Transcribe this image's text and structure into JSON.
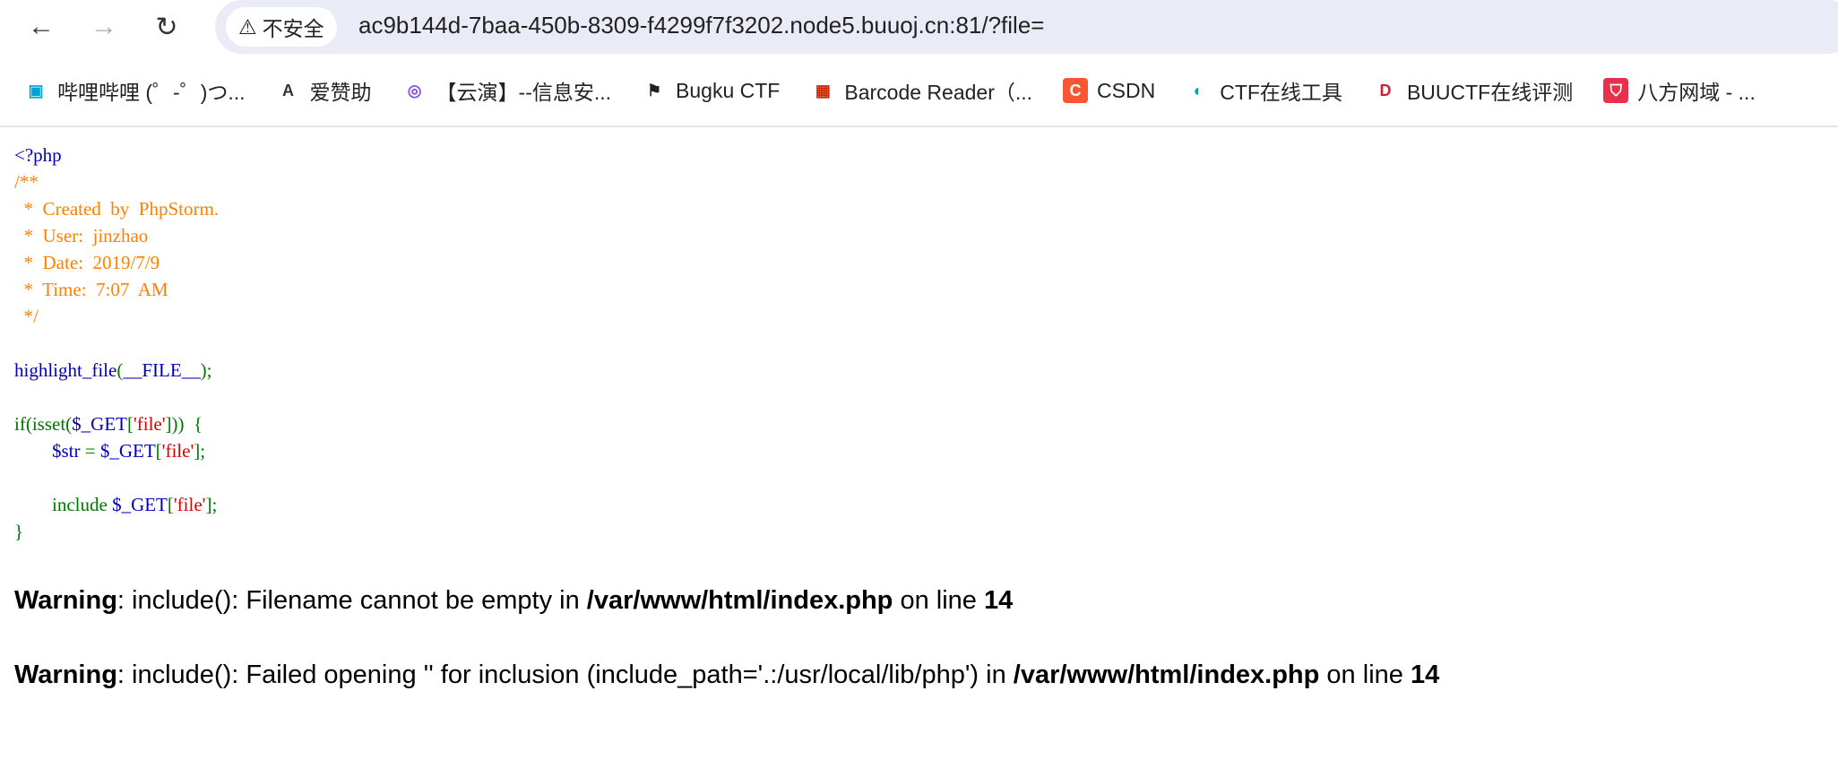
{
  "browser": {
    "security_label": "不安全",
    "url": "ac9b144d-7baa-450b-8309-f4299f7f3202.node5.buuoj.cn:81/?file=",
    "bookmarks": [
      {
        "label": "哔哩哔哩 (゜-゜)つ...",
        "icon": "bilibili-icon",
        "color": "#00a1d6"
      },
      {
        "label": "爱赞助",
        "icon": "aizanzhu-icon",
        "color": "#333333"
      },
      {
        "label": "【云演】--信息安...",
        "icon": "target-icon",
        "color": "#8a4fd8"
      },
      {
        "label": "Bugku CTF",
        "icon": "checkered-flag-icon",
        "color": "#222222"
      },
      {
        "label": "Barcode Reader（...",
        "icon": "barcode-reader-icon",
        "color": "#cc2200"
      },
      {
        "label": "CSDN",
        "icon": "csdn-icon",
        "color": "#fc5531"
      },
      {
        "label": "CTF在线工具",
        "icon": "ctf-tools-icon",
        "color": "#1a9e8f"
      },
      {
        "label": "BUUCTF在线评测",
        "icon": "dasctf-icon",
        "color": "#cc2233"
      },
      {
        "label": "八方网域 - ...",
        "icon": "shield-icon",
        "color": "#e8304a"
      }
    ]
  },
  "code": [
    [
      {
        "t": "<?php",
        "c": "blue"
      }
    ],
    [
      {
        "t": "/**",
        "c": "orange"
      }
    ],
    [
      {
        "t": "  *  Created  by  PhpStorm.",
        "c": "orange"
      }
    ],
    [
      {
        "t": "  *  User:  jinzhao",
        "c": "orange"
      }
    ],
    [
      {
        "t": "  *  Date:  2019/7/9",
        "c": "orange"
      }
    ],
    [
      {
        "t": "  *  Time:  7:07  AM",
        "c": "orange"
      }
    ],
    [
      {
        "t": "  */",
        "c": "orange"
      }
    ],
    [],
    [
      {
        "t": "highlight_file",
        "c": "blue"
      },
      {
        "t": "(",
        "c": "green"
      },
      {
        "t": "__FILE__",
        "c": "blue"
      },
      {
        "t": ");",
        "c": "green"
      }
    ],
    [],
    [
      {
        "t": "if(isset(",
        "c": "green"
      },
      {
        "t": "$_GET",
        "c": "blue"
      },
      {
        "t": "[",
        "c": "green"
      },
      {
        "t": "'file'",
        "c": "red"
      },
      {
        "t": "]))  {",
        "c": "green"
      }
    ],
    [
      {
        "t": "        ",
        "c": "green"
      },
      {
        "t": "$str ",
        "c": "blue"
      },
      {
        "t": "= ",
        "c": "green"
      },
      {
        "t": "$_GET",
        "c": "blue"
      },
      {
        "t": "[",
        "c": "green"
      },
      {
        "t": "'file'",
        "c": "red"
      },
      {
        "t": "];",
        "c": "green"
      }
    ],
    [],
    [
      {
        "t": "        include ",
        "c": "green"
      },
      {
        "t": "$_GET",
        "c": "blue"
      },
      {
        "t": "[",
        "c": "green"
      },
      {
        "t": "'file'",
        "c": "red"
      },
      {
        "t": "];",
        "c": "green"
      }
    ],
    [
      {
        "t": "}",
        "c": "green"
      }
    ]
  ],
  "warnings": [
    {
      "label": "Warning",
      "message": ": include(): Filename cannot be empty in ",
      "file": "/var/www/html/index.php",
      "on_line": " on line ",
      "line": "14"
    },
    {
      "label": "Warning",
      "message": ": include(): Failed opening '' for inclusion (include_path='.:/usr/local/lib/php') in ",
      "file": "/var/www/html/index.php",
      "on_line": " on line ",
      "line": "14"
    }
  ]
}
